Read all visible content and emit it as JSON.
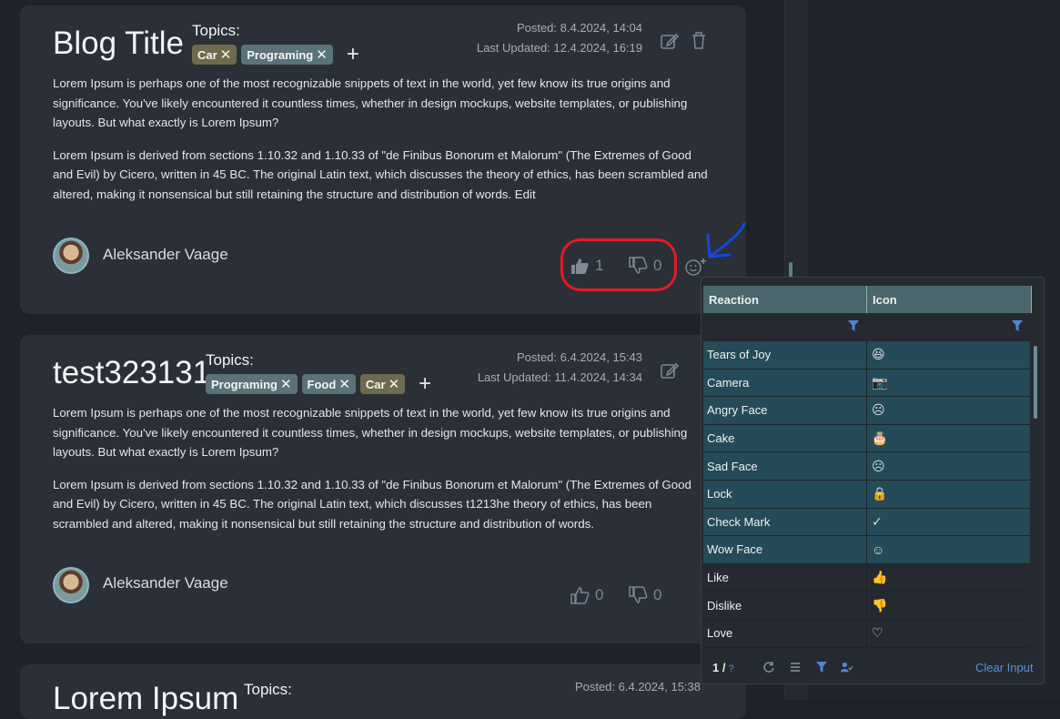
{
  "posts": [
    {
      "title": "Blog Title",
      "topics_label": "Topics:",
      "tags": [
        {
          "label": "Car",
          "color": "#6e6a4d"
        },
        {
          "label": "Programing",
          "color": "#5a7278"
        }
      ],
      "posted": "Posted: 8.4.2024, 14:04",
      "updated": "Last Updated: 12.4.2024, 16:19",
      "paragraph1": "Lorem Ipsum is perhaps one of the most recognizable snippets of text in the world, yet few know its true origins and significance. You've likely encountered it countless times, whether in design mockups, website templates, or publishing layouts. But what exactly is Lorem Ipsum?",
      "paragraph2": "Lorem Ipsum is derived from sections 1.10.32 and 1.10.33 of \"de Finibus Bonorum et Malorum\" (The Extremes of Good and Evil) by Cicero, written in 45 BC. The original Latin text, which discusses the theory of ethics, has been scrambled and altered, making it nonsensical but still retaining the structure and distribution of words. Edit",
      "author": "Aleksander Vaage",
      "likes": "1",
      "dislikes": "0"
    },
    {
      "title": "test323131",
      "topics_label": "Topics:",
      "tags": [
        {
          "label": "Programing",
          "color": "#5a7278"
        },
        {
          "label": "Food",
          "color": "#5a7278"
        },
        {
          "label": "Car",
          "color": "#6e6a4d"
        }
      ],
      "posted": "Posted: 6.4.2024, 15:43",
      "updated": "Last Updated: 11.4.2024, 14:34",
      "paragraph1": "Lorem Ipsum is perhaps one of the most recognizable snippets of text in the world, yet few know its true origins and significance. You've likely encountered it countless times, whether in design mockups, website templates, or publishing layouts. But what exactly is Lorem Ipsum?",
      "paragraph2": "Lorem Ipsum is derived from sections 1.10.32 and 1.10.33 of \"de Finibus Bonorum et Malorum\" (The Extremes of Good and Evil) by Cicero, written in 45 BC. The original Latin text, which discusses t1213he theory of ethics, has been scrambled and altered, making it nonsensical but still retaining the structure and distribution of words.",
      "author": "Aleksander Vaage",
      "likes": "0",
      "dislikes": "0"
    },
    {
      "title": "Lorem Ipsum",
      "topics_label": "Topics:",
      "posted": "Posted: 6.4.2024, 15:38"
    }
  ],
  "reaction_grid": {
    "columns": [
      "Reaction",
      "Icon"
    ],
    "rows": [
      {
        "reaction": "Tears of Joy",
        "icon": "😆",
        "icon_name": "tears-of-joy-icon",
        "selected": true
      },
      {
        "reaction": "Camera",
        "icon": "📷",
        "icon_name": "camera-icon",
        "selected": true
      },
      {
        "reaction": "Angry Face",
        "icon": "☹",
        "icon_name": "angry-face-icon",
        "selected": true
      },
      {
        "reaction": "Cake",
        "icon": "🎂",
        "icon_name": "cake-icon",
        "selected": true
      },
      {
        "reaction": "Sad Face",
        "icon": "☹",
        "icon_name": "sad-face-icon",
        "selected": true
      },
      {
        "reaction": "Lock",
        "icon": "🔒",
        "icon_name": "lock-icon",
        "selected": true
      },
      {
        "reaction": "Check Mark",
        "icon": "✓",
        "icon_name": "check-mark-icon",
        "selected": true
      },
      {
        "reaction": "Wow Face",
        "icon": "☺",
        "icon_name": "wow-face-icon",
        "selected": true
      },
      {
        "reaction": "Like",
        "icon": "👍",
        "icon_name": "like-icon",
        "selected": false
      },
      {
        "reaction": "Dislike",
        "icon": "👎",
        "icon_name": "dislike-icon",
        "selected": false
      },
      {
        "reaction": "Love",
        "icon": "♡",
        "icon_name": "heart-icon",
        "selected": false
      }
    ],
    "page": "1 /",
    "page_help": "?",
    "clear_label": "Clear Input"
  },
  "colors": {
    "annotation_red": "#e31b23",
    "annotation_blue": "#1646e0",
    "selected_row": "#244b57",
    "grid_header": "#4a656b"
  }
}
